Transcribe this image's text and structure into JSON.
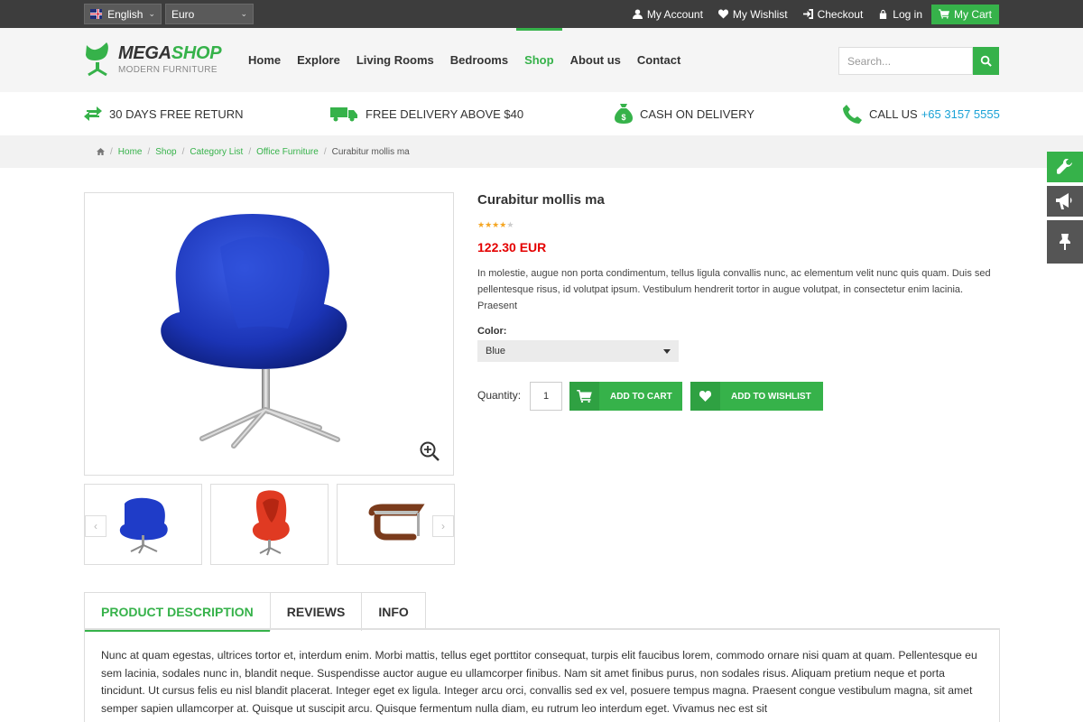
{
  "topbar": {
    "language": "English",
    "currency": "Euro",
    "links": [
      "My Account",
      "My Wishlist",
      "Checkout",
      "Log in"
    ],
    "cart": "My Cart"
  },
  "logo": {
    "name_part1": "MEGA",
    "name_part2": "SHOP",
    "tagline": "MODERN FURNITURE"
  },
  "nav": [
    "Home",
    "Explore",
    "Living Rooms",
    "Bedrooms",
    "Shop",
    "About us",
    "Contact"
  ],
  "nav_active": "Shop",
  "search": {
    "placeholder": "Search..."
  },
  "features": {
    "return": "30 DAYS FREE RETURN",
    "delivery": "FREE DELIVERY ABOVE $40",
    "cash": "CASH ON DELIVERY",
    "call_label": "CALL US",
    "phone": "+65 3157 5555"
  },
  "breadcrumb": [
    "Home",
    "Shop",
    "Category List",
    "Office Furniture"
  ],
  "breadcrumb_current": "Curabitur mollis ma",
  "product": {
    "title": "Curabitur mollis ma",
    "rating": 4.5,
    "price": "122.30 EUR",
    "description": "In molestie, augue non porta condimentum, tellus ligula convallis nunc, ac elementum velit nunc quis quam. Duis sed pellentesque risus, id volutpat ipsum. Vestibulum hendrerit tortor in augue volutpat, in consectetur enim lacinia. Praesent",
    "color_label": "Color:",
    "color_value": "Blue",
    "quantity_label": "Quantity:",
    "quantity": "1",
    "add_to_cart": "ADD TO CART",
    "add_to_wishlist": "ADD TO WISHLIST"
  },
  "tabs": [
    "PRODUCT DESCRIPTION",
    "REVIEWS",
    "INFO"
  ],
  "tab_active": "PRODUCT DESCRIPTION",
  "tab_content": "Nunc at quam egestas, ultrices tortor et, interdum enim. Morbi mattis, tellus eget porttitor consequat, turpis elit faucibus lorem, commodo ornare nisi quam at quam. Pellentesque eu sem lacinia, sodales nunc in, blandit neque. Suspendisse auctor augue eu ullamcorper finibus. Nam sit amet finibus purus, non sodales risus. Aliquam pretium neque et porta tincidunt. Ut cursus felis eu nisl blandit placerat. Integer eget ex ligula. Integer arcu orci, convallis sed ex vel, posuere tempus magna. Praesent congue vestibulum magna, sit amet semper sapien ullamcorper at. Quisque ut suscipit arcu. Quisque fermentum nulla diam, eu rutrum leo interdum eget. Vivamus nec est sit",
  "colors": {
    "accent": "#36b24a",
    "price": "#e40000",
    "phone": "#1aa2d6",
    "topbar": "#3d3d3d"
  }
}
